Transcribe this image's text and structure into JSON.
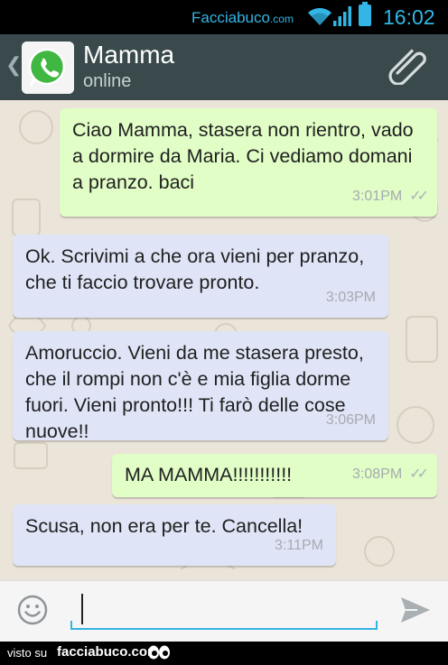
{
  "status_bar": {
    "carrier": "Facciabuco",
    "carrier_suffix": ".com",
    "time": "16:02",
    "wifi_icon": "wifi-icon",
    "signal_icon": "signal-icon",
    "battery_icon": "battery-icon"
  },
  "header": {
    "back_glyph": "❮",
    "contact_name": "Mamma",
    "presence": "online",
    "avatar_icon": "whatsapp-logo-icon",
    "attach_icon": "paperclip-icon"
  },
  "messages": [
    {
      "direction": "out",
      "text": "Ciao Mamma, stasera non rientro, vado a dormire da Maria. Ci vediamo domani a pranzo. baci",
      "time": "3:01PM",
      "read": true
    },
    {
      "direction": "in",
      "text": "Ok. Scrivimi a che ora vieni per pranzo, che ti faccio trovare pronto.",
      "time": "3:03PM"
    },
    {
      "direction": "in",
      "text": "Amoruccio. Vieni da me stasera presto, che il rompi non c'è e mia figlia dorme fuori. Vieni pronto!!! Ti farò delle cose nuove!!",
      "time": "3:06PM"
    },
    {
      "direction": "out",
      "text": "MA MAMMA!!!!!!!!!!!",
      "time": "3:08PM",
      "read": true
    },
    {
      "direction": "in",
      "text": "Scusa, non era per te. Cancella!",
      "time": "3:11PM"
    }
  ],
  "composer": {
    "value": "",
    "emoji_icon": "smiley-icon",
    "send_icon": "send-icon"
  },
  "watermark": {
    "prefix": "visto su",
    "site": "facciabuco.com"
  },
  "colors": {
    "status_accent": "#33b5e5",
    "header_bg": "#3a4a4c",
    "chat_bg": "#ebe5d9",
    "outgoing_bubble": "#e1fec6",
    "incoming_bubble": "#dfe5f7",
    "input_underline": "#34b4e1"
  }
}
